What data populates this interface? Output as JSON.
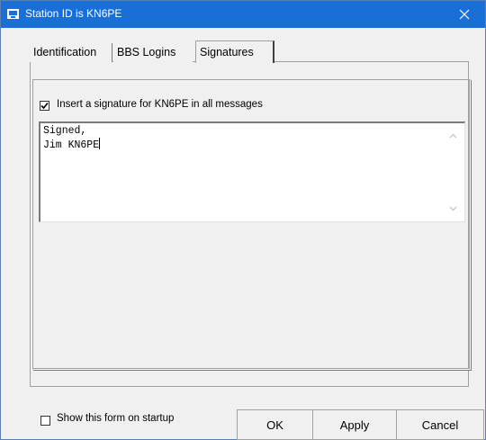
{
  "window": {
    "title": "Station ID is KN6PE",
    "close_glyph": "✕"
  },
  "tabs": [
    {
      "label": "Identification"
    },
    {
      "label": "BBS Logins"
    },
    {
      "label": "Signatures",
      "selected": true
    }
  ],
  "signature": {
    "checkbox_checked": true,
    "checkbox_label": "Insert a signature for KN6PE in all messages",
    "text_line1": "Signed,",
    "text_line2": "Jim KN6PE"
  },
  "footer": {
    "startup_checked": false,
    "startup_label": "Show this form on startup",
    "ok_label": "OK",
    "apply_label": "Apply",
    "cancel_label": "Cancel"
  },
  "colors": {
    "title_bar": "#1a6fd6",
    "dialog_bg": "#f0f0f0"
  }
}
